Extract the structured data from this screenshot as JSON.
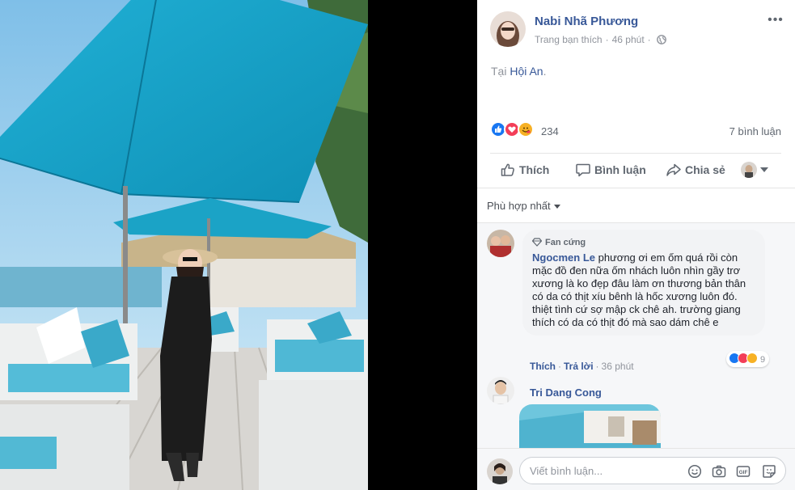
{
  "post": {
    "author": "Nabi Nhã Phương",
    "audience_label": "Trang bạn thích",
    "time": "46 phút",
    "dot": "·",
    "more_label": "•••",
    "text_prefix": "Tại ",
    "location": "Hội An",
    "text_suffix": ".",
    "reaction_count": "234",
    "comment_count": "7 bình luận"
  },
  "actions": {
    "like": "Thích",
    "comment": "Bình luận",
    "share": "Chia sẻ"
  },
  "comments_section": {
    "sort_label": "Phù hợp nhất",
    "items": [
      {
        "badge": "Fan cứng",
        "name": "Ngocmen Le",
        "text": "phương ơi em ốm quá rồi còn mặc đồ đen nữa ốm nhách luôn nhìn gầy trơ xương là ko đẹp đâu làm ơn thương bản thân có da có thịt xíu bênh là hốc xương luôn đó. thiệt tình cứ sợ mập ck chê ah. trường giang thích có da có thịt đó mà sao dám chê e",
        "like_label": "Thích",
        "reply_label": "Trả lời",
        "time": "36 phút",
        "reaction_count": "9"
      },
      {
        "name": "Tri Dang Cong"
      }
    ]
  },
  "composer": {
    "placeholder": "Viết bình luận..."
  },
  "colors": {
    "link": "#385898",
    "like_blue": "#1877f2",
    "love_red": "#f33e58",
    "haha_yellow": "#f7b125",
    "umbrella": "#1ba3c6"
  },
  "icons": [
    "globe-icon",
    "like-icon",
    "comment-icon",
    "share-icon",
    "diamond-icon",
    "emoji-icon",
    "camera-icon",
    "gif-icon",
    "sticker-icon"
  ]
}
